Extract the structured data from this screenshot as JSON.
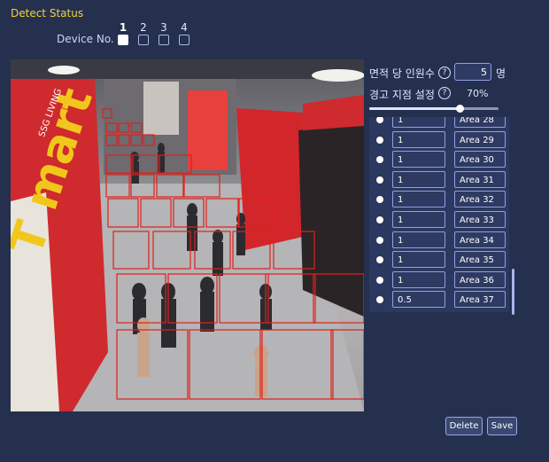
{
  "header": {
    "title": "Detect Status"
  },
  "device": {
    "label": "Device No.",
    "numbers": [
      "1",
      "2",
      "3",
      "4"
    ],
    "checked": [
      true,
      false,
      false,
      false
    ]
  },
  "settings": {
    "people_per_area_label": "면적 당 인원수",
    "people_per_area_value": "5",
    "people_unit": "명",
    "warning_point_label": "경고 지점 설정",
    "warning_point_percent": "70%",
    "warning_point_fraction": 0.7,
    "help_glyph": "?"
  },
  "areas": [
    {
      "value": "1",
      "name": "Area 28"
    },
    {
      "value": "1",
      "name": "Area 29"
    },
    {
      "value": "1",
      "name": "Area 30"
    },
    {
      "value": "1",
      "name": "Area 31"
    },
    {
      "value": "1",
      "name": "Area 32"
    },
    {
      "value": "1",
      "name": "Area 33"
    },
    {
      "value": "1",
      "name": "Area 34"
    },
    {
      "value": "1",
      "name": "Area 35"
    },
    {
      "value": "1",
      "name": "Area 36"
    },
    {
      "value": "0.5",
      "name": "Area 37"
    }
  ],
  "camera": {
    "signage_text": "T mart",
    "store_text": "SSG LIVING"
  },
  "buttons": {
    "delete": "Delete",
    "save": "Save"
  },
  "colors": {
    "title": "#f3d23a",
    "background": "#25304f",
    "grid": "#e0201c",
    "accent_red": "#d8232a"
  }
}
